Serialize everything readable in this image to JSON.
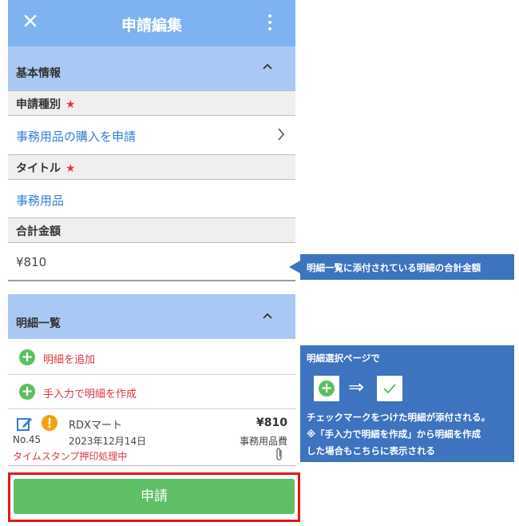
{
  "header": {
    "title": "申請編集"
  },
  "basic_section": {
    "label": "基本情報"
  },
  "fields": {
    "type_label": "申請種別",
    "type_value": "事務用品の購入を申請",
    "title_label": "タイトル",
    "title_value": "事務用品",
    "total_label": "合計金額",
    "total_value": "¥810"
  },
  "details_section": {
    "label": "明細一覧"
  },
  "actions": {
    "add_detail": "明細を追加",
    "manual_create": "手入力で明細を作成"
  },
  "detail_item": {
    "store": "RDXマート",
    "amount": "¥810",
    "number": "No.45",
    "date": "2023年12月14日",
    "category": "事務用品費",
    "status": "タイムスタンプ押印処理中"
  },
  "submit": {
    "label": "申請"
  },
  "callouts": {
    "total_note": "明細一覧に添付されている明細の合計金額",
    "select_title": "明細選択ページで",
    "select_line1": "チェックマークをつけた明細が添付される。",
    "select_line2": "※「手入力で明細を作成」から明細を作成",
    "select_line3": "した場合もこちらに表示される"
  },
  "colors": {
    "header": "#7fb2f0",
    "section": "#a9c9f4",
    "accent_blue": "#2f7fd6",
    "green": "#5fbf67",
    "red": "#d9363e",
    "callout": "#3d73bf"
  }
}
